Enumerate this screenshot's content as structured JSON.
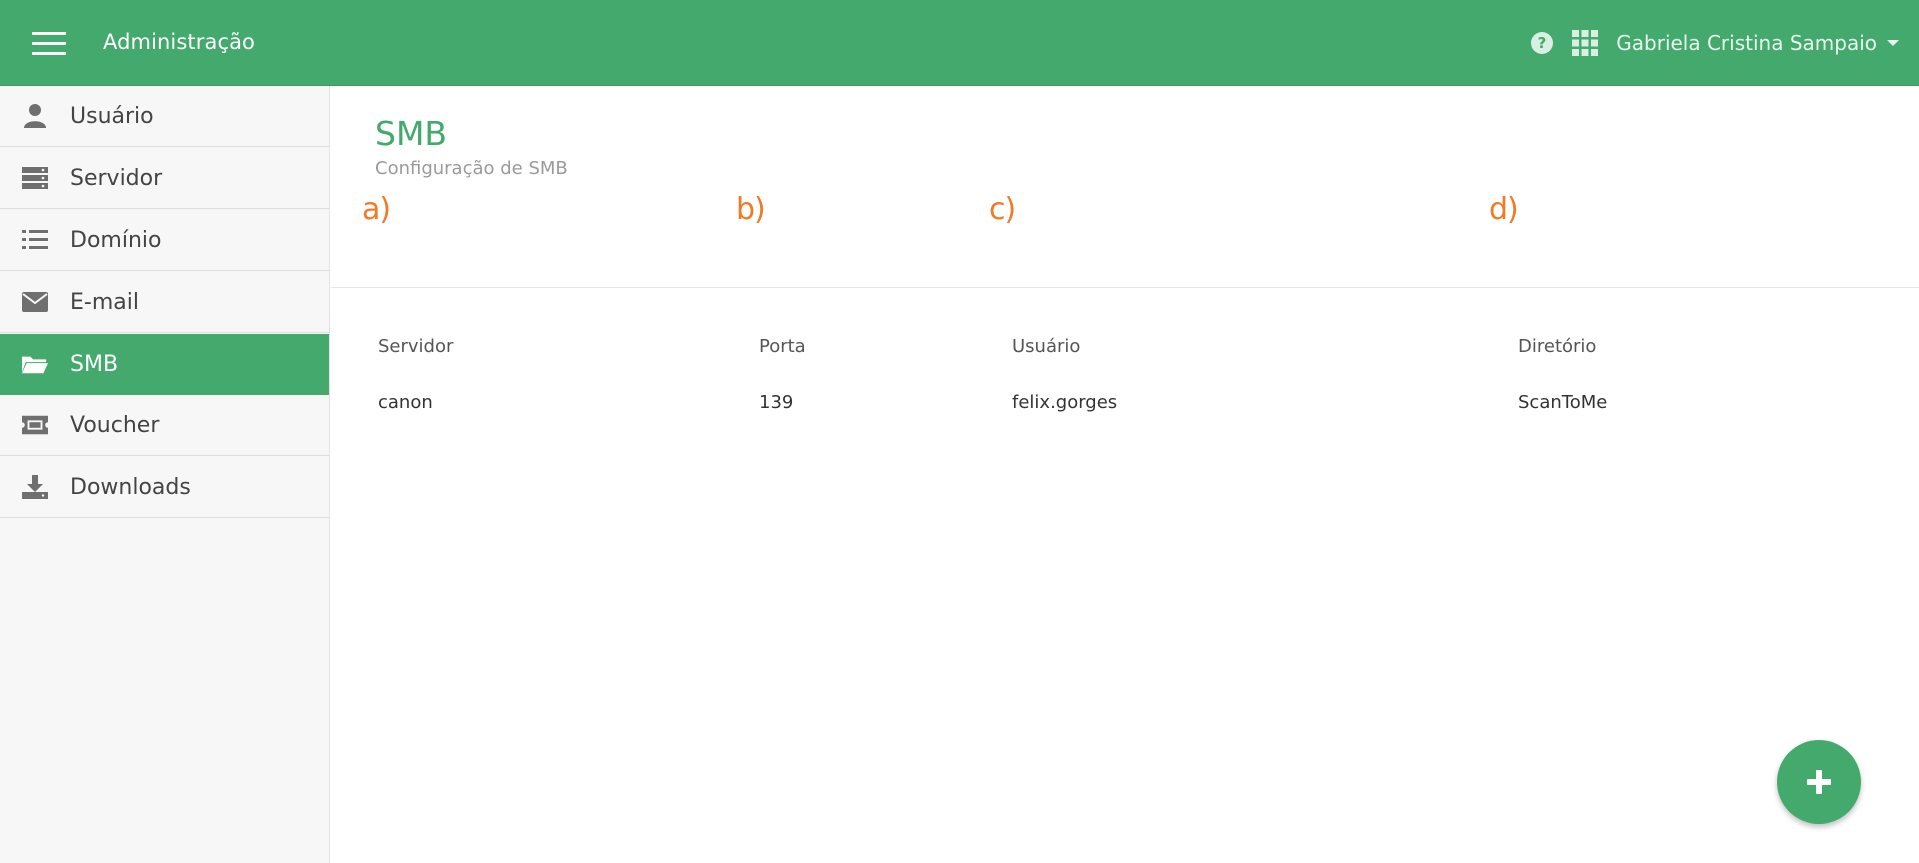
{
  "header": {
    "title": "Administração",
    "user_name": "Gabriela Cristina Sampaio",
    "accent_color": "#43a96d"
  },
  "sidebar": {
    "items": [
      {
        "label": "Usuário",
        "icon": "user-icon"
      },
      {
        "label": "Servidor",
        "icon": "server-icon"
      },
      {
        "label": "Domínio",
        "icon": "list-icon"
      },
      {
        "label": "E-mail",
        "icon": "envelope-icon"
      },
      {
        "label": "SMB",
        "icon": "folder-open-icon",
        "active": true
      },
      {
        "label": "Voucher",
        "icon": "ticket-icon"
      },
      {
        "label": "Downloads",
        "icon": "download-icon"
      }
    ]
  },
  "main": {
    "title": "SMB",
    "subtitle": "Configuração de SMB",
    "markers": [
      "a)",
      "b)",
      "c)",
      "d)"
    ],
    "table": {
      "columns": [
        "Servidor",
        "Porta",
        "Usuário",
        "Diretório"
      ],
      "rows": [
        [
          "canon",
          "139",
          "felix.gorges",
          "ScanToMe"
        ]
      ]
    }
  },
  "fab": {
    "icon": "plus-icon"
  }
}
